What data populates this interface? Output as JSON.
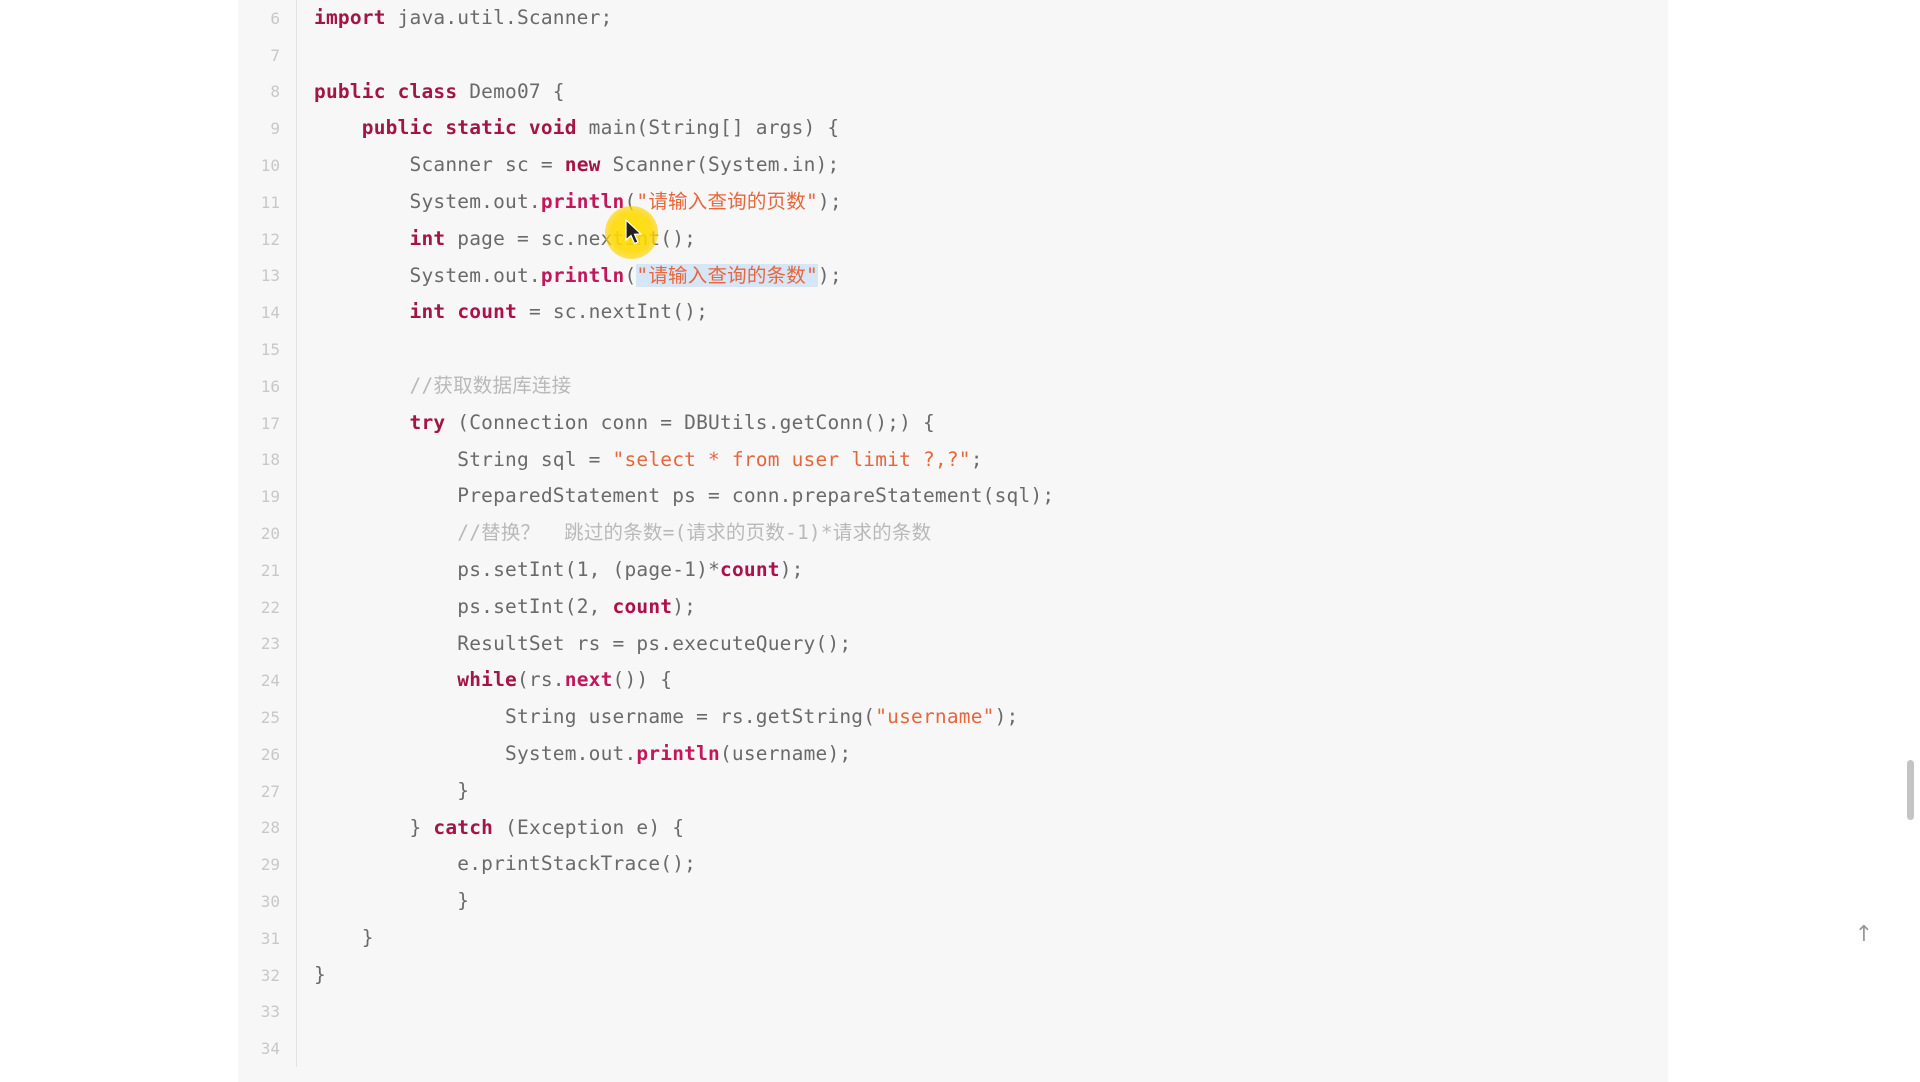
{
  "editor": {
    "language": "java",
    "first_line": 6,
    "last_line": 34,
    "selection_line": 13,
    "colors": {
      "background": "#f7f7f7",
      "page_background": "#ffffff",
      "gutter_text": "#c8c8c8",
      "plain_text": "#6a6a6a",
      "keyword": "#a31545",
      "method": "#c2185b",
      "variable": "#b0104a",
      "string": "#e8663d",
      "comment": "#b9b9b9",
      "selection": "#d6e6f7",
      "cursor_glow": "#ffe200",
      "scrollbar_thumb": "#c4c4c4"
    },
    "lines": [
      {
        "num": "6",
        "indent": 0,
        "tokens": [
          {
            "t": "import",
            "c": "kw"
          },
          {
            "t": " java.util.Scanner;",
            "c": "plain"
          }
        ]
      },
      {
        "num": "7",
        "indent": 0,
        "tokens": []
      },
      {
        "num": "8",
        "indent": 0,
        "tokens": [
          {
            "t": "public class",
            "c": "kw"
          },
          {
            "t": " Demo07 {",
            "c": "plain"
          }
        ]
      },
      {
        "num": "9",
        "indent": 1,
        "tokens": [
          {
            "t": "public static void",
            "c": "kw"
          },
          {
            "t": " main(String[] args) {",
            "c": "plain"
          }
        ]
      },
      {
        "num": "10",
        "indent": 2,
        "tokens": [
          {
            "t": "Scanner sc = ",
            "c": "plain"
          },
          {
            "t": "new",
            "c": "kw"
          },
          {
            "t": " Scanner(System.in);",
            "c": "plain"
          }
        ]
      },
      {
        "num": "11",
        "indent": 2,
        "tokens": [
          {
            "t": "System.out.",
            "c": "plain"
          },
          {
            "t": "println",
            "c": "mth"
          },
          {
            "t": "(",
            "c": "plain"
          },
          {
            "t": "\"请输入查询的页数\"",
            "c": "str"
          },
          {
            "t": ");",
            "c": "plain"
          }
        ]
      },
      {
        "num": "12",
        "indent": 2,
        "tokens": [
          {
            "t": "int",
            "c": "kw"
          },
          {
            "t": " page = sc.nextInt();",
            "c": "plain"
          }
        ]
      },
      {
        "num": "13",
        "indent": 2,
        "tokens": [
          {
            "t": "System.out.",
            "c": "plain"
          },
          {
            "t": "println",
            "c": "mth"
          },
          {
            "t": "(",
            "c": "plain"
          },
          {
            "t": "\"请输入查询的条数\"",
            "c": "str",
            "sel": true
          },
          {
            "t": ");",
            "c": "plain"
          }
        ]
      },
      {
        "num": "14",
        "indent": 2,
        "tokens": [
          {
            "t": "int",
            "c": "kw"
          },
          {
            "t": " ",
            "c": "plain"
          },
          {
            "t": "count",
            "c": "var"
          },
          {
            "t": " = sc.nextInt();",
            "c": "plain"
          }
        ]
      },
      {
        "num": "15",
        "indent": 0,
        "tokens": []
      },
      {
        "num": "16",
        "indent": 2,
        "tokens": [
          {
            "t": "//获取数据库连接",
            "c": "cmt"
          }
        ]
      },
      {
        "num": "17",
        "indent": 2,
        "tokens": [
          {
            "t": "try",
            "c": "kw"
          },
          {
            "t": " (Connection conn = DBUtils.getConn();) {",
            "c": "plain"
          }
        ]
      },
      {
        "num": "18",
        "indent": 3,
        "tokens": [
          {
            "t": "String sql = ",
            "c": "plain"
          },
          {
            "t": "\"select * from user limit ?,?\"",
            "c": "str"
          },
          {
            "t": ";",
            "c": "plain"
          }
        ]
      },
      {
        "num": "19",
        "indent": 3,
        "tokens": [
          {
            "t": "PreparedStatement ps = conn.prepareStatement(sql);",
            "c": "plain"
          }
        ]
      },
      {
        "num": "20",
        "indent": 3,
        "tokens": [
          {
            "t": "//替换？  跳过的条数=(请求的页数-1)*请求的条数",
            "c": "cmt"
          }
        ]
      },
      {
        "num": "21",
        "indent": 3,
        "tokens": [
          {
            "t": "ps.setInt(",
            "c": "plain"
          },
          {
            "t": "1",
            "c": "num"
          },
          {
            "t": ", (page-",
            "c": "plain"
          },
          {
            "t": "1",
            "c": "num"
          },
          {
            "t": ")*",
            "c": "plain"
          },
          {
            "t": "count",
            "c": "var"
          },
          {
            "t": ");",
            "c": "plain"
          }
        ]
      },
      {
        "num": "22",
        "indent": 3,
        "tokens": [
          {
            "t": "ps.setInt(",
            "c": "plain"
          },
          {
            "t": "2",
            "c": "num"
          },
          {
            "t": ", ",
            "c": "plain"
          },
          {
            "t": "count",
            "c": "var"
          },
          {
            "t": ");",
            "c": "plain"
          }
        ]
      },
      {
        "num": "23",
        "indent": 3,
        "tokens": [
          {
            "t": "ResultSet rs = ps.executeQuery();",
            "c": "plain"
          }
        ]
      },
      {
        "num": "24",
        "indent": 3,
        "tokens": [
          {
            "t": "while",
            "c": "kw"
          },
          {
            "t": "(rs.",
            "c": "plain"
          },
          {
            "t": "next",
            "c": "mth"
          },
          {
            "t": "()) {",
            "c": "plain"
          }
        ]
      },
      {
        "num": "25",
        "indent": 4,
        "tokens": [
          {
            "t": "String username = rs.getString(",
            "c": "plain"
          },
          {
            "t": "\"username\"",
            "c": "str"
          },
          {
            "t": ");",
            "c": "plain"
          }
        ]
      },
      {
        "num": "26",
        "indent": 4,
        "tokens": [
          {
            "t": "System.out.",
            "c": "plain"
          },
          {
            "t": "println",
            "c": "mth"
          },
          {
            "t": "(username);",
            "c": "plain"
          }
        ]
      },
      {
        "num": "27",
        "indent": 3,
        "tokens": [
          {
            "t": "}",
            "c": "plain"
          }
        ]
      },
      {
        "num": "28",
        "indent": 2,
        "tokens": [
          {
            "t": "} ",
            "c": "plain"
          },
          {
            "t": "catch",
            "c": "kw"
          },
          {
            "t": " (Exception e) {",
            "c": "plain"
          }
        ]
      },
      {
        "num": "29",
        "indent": 3,
        "tokens": [
          {
            "t": "e.printStackTrace();",
            "c": "plain"
          }
        ]
      },
      {
        "num": "30",
        "indent": 3,
        "tokens": [
          {
            "t": "}",
            "c": "plain"
          }
        ]
      },
      {
        "num": "31",
        "indent": 1,
        "tokens": [
          {
            "t": "}",
            "c": "plain"
          }
        ]
      },
      {
        "num": "32",
        "indent": 0,
        "tokens": [
          {
            "t": "}",
            "c": "plain"
          }
        ]
      },
      {
        "num": "33",
        "indent": 0,
        "tokens": []
      },
      {
        "num": "34",
        "indent": 0,
        "tokens": []
      }
    ]
  },
  "controls": {
    "back_to_top_icon": "arrow-up-icon",
    "back_to_top_glyph": "↑"
  }
}
